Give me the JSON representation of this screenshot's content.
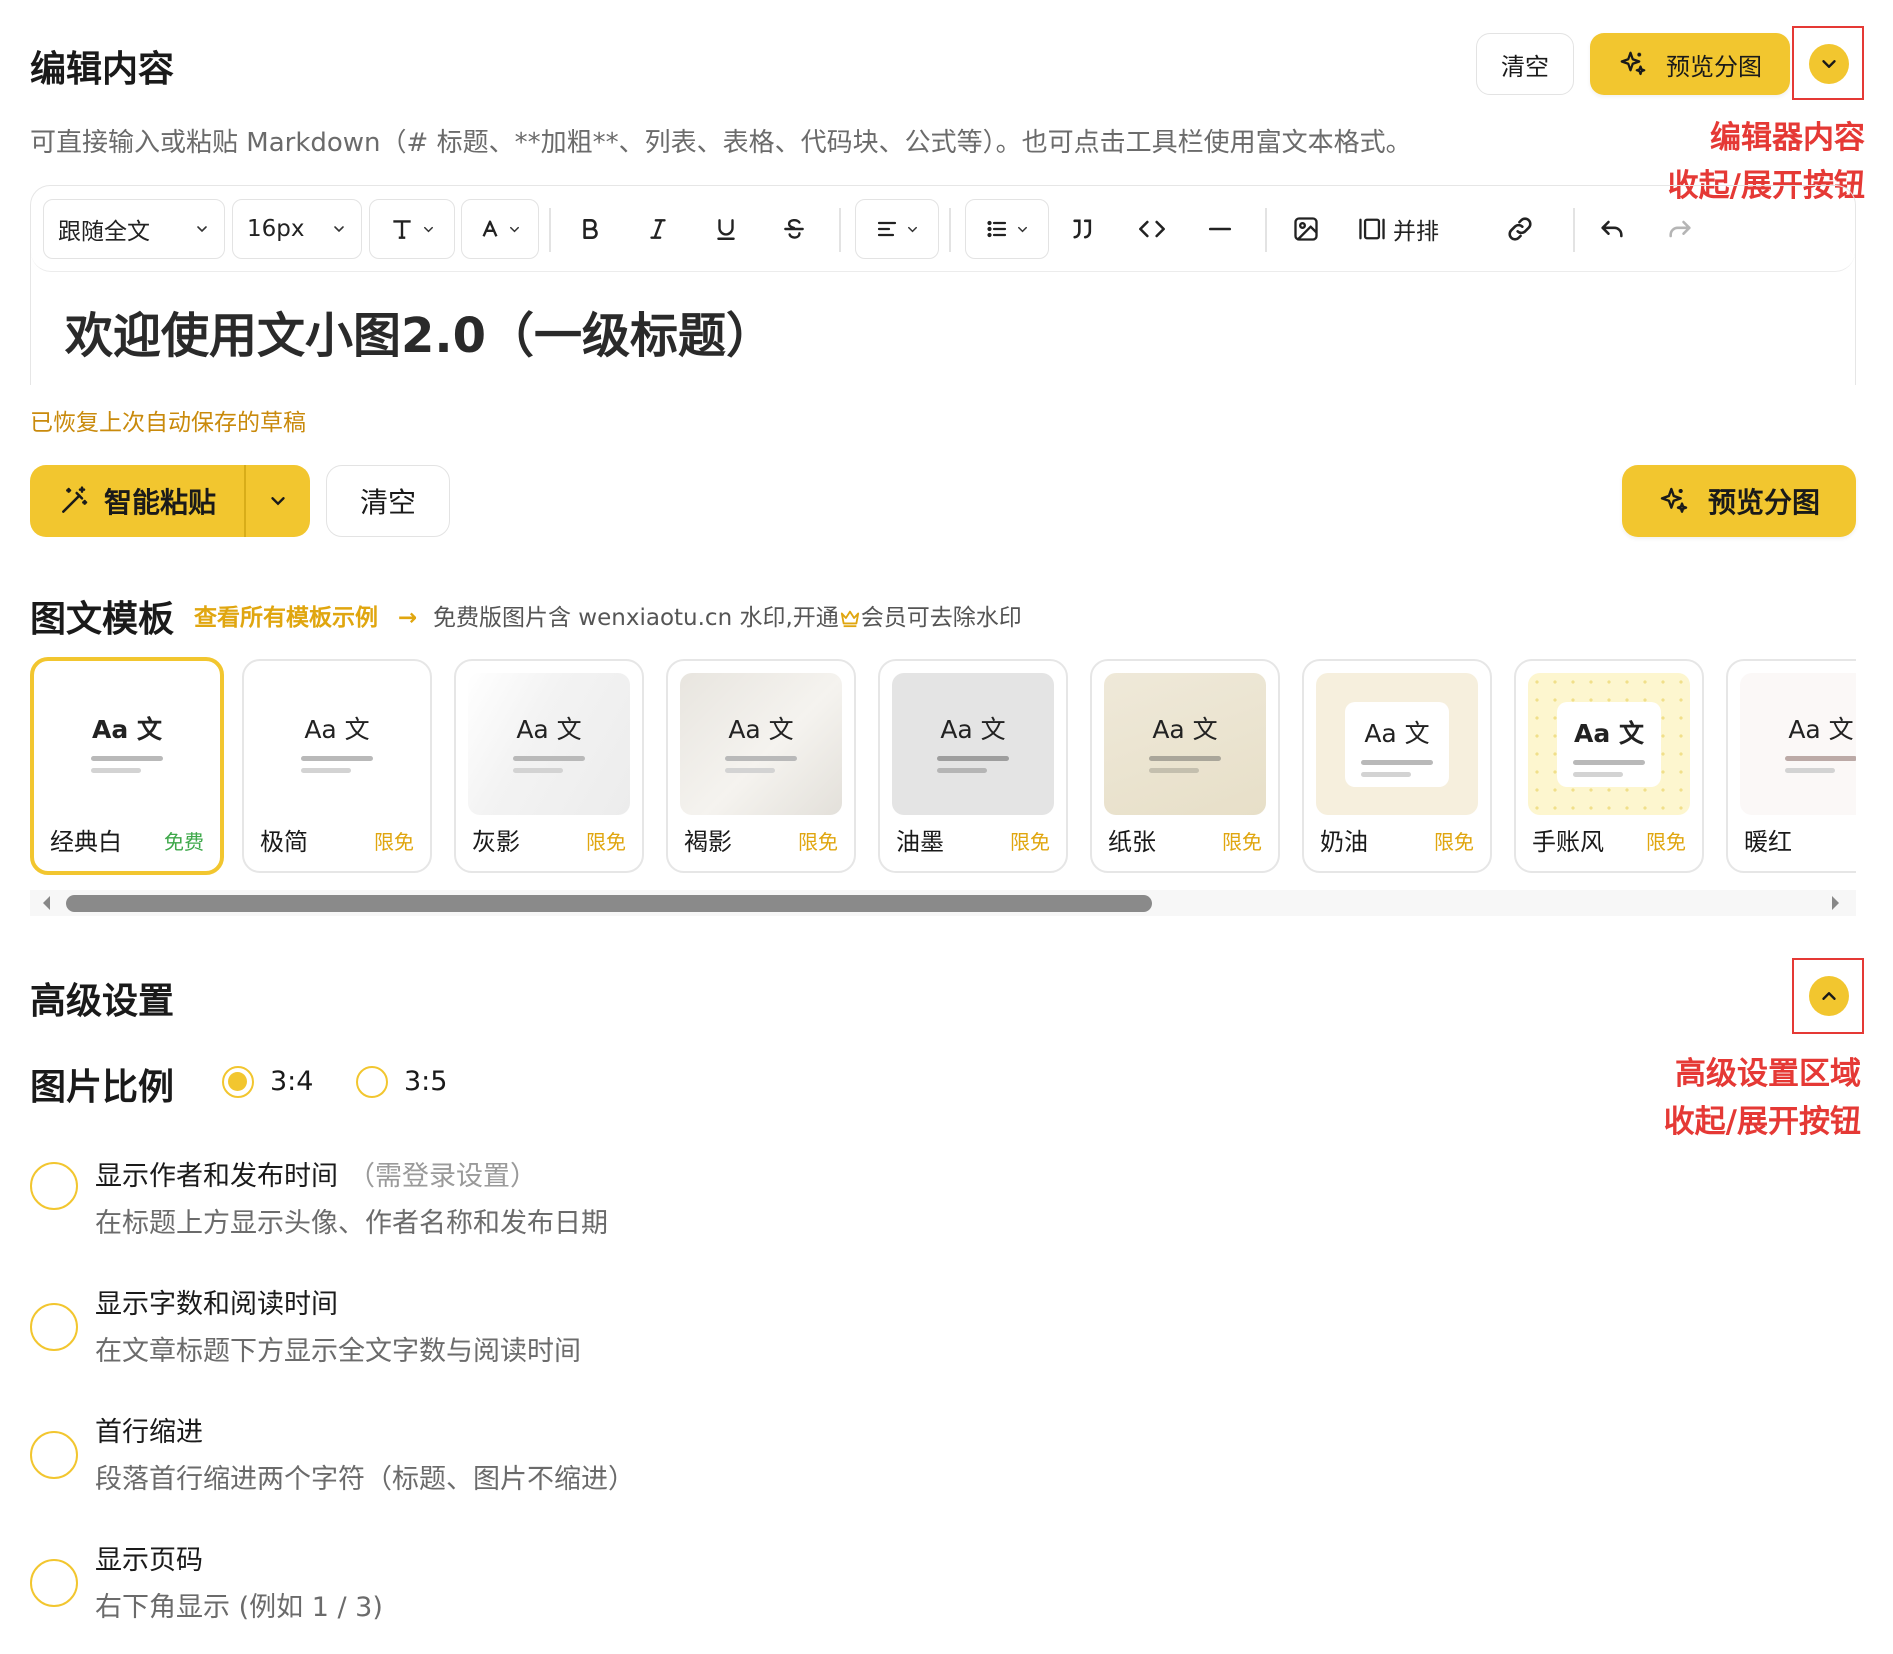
{
  "header": {
    "title": "编辑内容",
    "clear_label": "清空",
    "preview_label": "预览分图",
    "hint": "可直接输入或粘贴 Markdown（# 标题、**加粗**、列表、表格、代码块、公式等）。也可点击工具栏使用富文本格式。"
  },
  "annotations": {
    "editor_toggle_line1": "编辑器内容",
    "editor_toggle_line2": "收起/展开按钮",
    "advanced_toggle_line1": "高级设置区域",
    "advanced_toggle_line2": "收起/展开按钮",
    "color": "#e53935"
  },
  "toolbar": {
    "font_select": "跟随全文",
    "size_select": "16px",
    "side_by_side_label": "并排",
    "icons": [
      "heading-icon",
      "font-color-icon",
      "bold-icon",
      "italic-icon",
      "underline-icon",
      "strikethrough-icon",
      "align-icon",
      "list-icon",
      "quote-icon",
      "code-icon",
      "divider-icon",
      "image-icon",
      "side-by-side-icon",
      "link-icon",
      "undo-icon",
      "redo-icon"
    ]
  },
  "editor": {
    "content_h1": "欢迎使用文小图2.0（一级标题）",
    "draft_status": "已恢复上次自动保存的草稿"
  },
  "actions": {
    "smart_paste_label": "智能粘贴",
    "clear_label": "清空",
    "preview_label": "预览分图"
  },
  "templates": {
    "title": "图文模板",
    "view_all_link": "查看所有模板示例",
    "watermark_note_prefix": "免费版图片含 wenxiaotu.cn 水印,开通",
    "watermark_note_suffix": "会员可去除水印",
    "thumb_text": "Aa 文",
    "items": [
      {
        "name": "经典白",
        "tag": "免费"
      },
      {
        "name": "极简",
        "tag": "限免"
      },
      {
        "name": "灰影",
        "tag": "限免"
      },
      {
        "name": "褐影",
        "tag": "限免"
      },
      {
        "name": "油墨",
        "tag": "限免"
      },
      {
        "name": "纸张",
        "tag": "限免"
      },
      {
        "name": "奶油",
        "tag": "限免"
      },
      {
        "name": "手账风",
        "tag": "限免"
      },
      {
        "name": "暖红",
        "tag": ""
      }
    ],
    "selected_index": 0
  },
  "advanced": {
    "title": "高级设置",
    "ratio_label": "图片比例",
    "ratio_options": [
      "3:4",
      "3:5"
    ],
    "ratio_selected": "3:4",
    "options": [
      {
        "title": "显示作者和发布时间",
        "note": "（需登录设置）",
        "desc": "在标题上方显示头像、作者名称和发布日期"
      },
      {
        "title": "显示字数和阅读时间",
        "note": "",
        "desc": "在文章标题下方显示全文字数与阅读时间"
      },
      {
        "title": "首行缩进",
        "note": "",
        "desc": "段落首行缩进两个字符（标题、图片不缩进）"
      },
      {
        "title": "显示页码",
        "note": "",
        "desc": "右下角显示 (例如 1 / 3)"
      }
    ]
  },
  "colors": {
    "accent": "#f2c62f",
    "link": "#e0a60f",
    "draft": "#c98a0c",
    "free_tag": "#3ea84a"
  }
}
